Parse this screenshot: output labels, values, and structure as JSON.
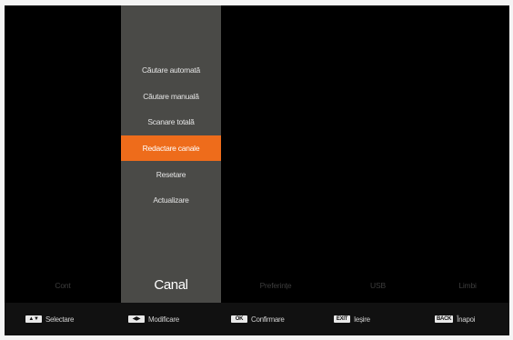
{
  "menu": {
    "items": [
      {
        "label": "Căutare automată",
        "selected": false
      },
      {
        "label": "Căutare manuală",
        "selected": false
      },
      {
        "label": "Scanare totală",
        "selected": false
      },
      {
        "label": "Redactare canale",
        "selected": true
      },
      {
        "label": "Resetare",
        "selected": false
      },
      {
        "label": "Actualizare",
        "selected": false
      }
    ]
  },
  "tabs": [
    {
      "label": "Cont",
      "active": false
    },
    {
      "label": "Canal",
      "active": true
    },
    {
      "label": "Preferințe",
      "active": false
    },
    {
      "label": "USB",
      "active": false
    },
    {
      "label": "Limbi",
      "active": false
    }
  ],
  "footer": {
    "hints": [
      {
        "key": "▲▼",
        "label": "Selectare"
      },
      {
        "key": "◀▶",
        "label": "Modificare"
      },
      {
        "key": "OK",
        "label": "Confirmare"
      },
      {
        "key": "EXIT",
        "label": "Ieșire"
      },
      {
        "key": "BACK",
        "label": "Înapoi"
      }
    ]
  },
  "colors": {
    "background": "#000000",
    "menu_panel": "#4a4a47",
    "selected_item": "#ee6c1b",
    "footer": "#111111",
    "inactive_tab_text": "#3e3e3e",
    "active_tab_text": "#ffffff"
  }
}
